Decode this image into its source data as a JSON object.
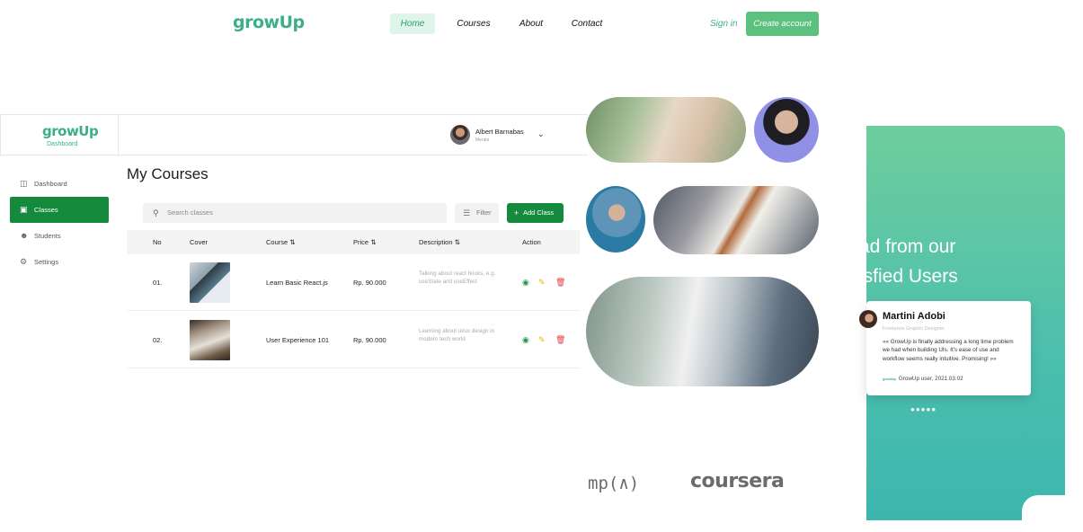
{
  "topnav": {
    "logo": "growUp",
    "links": [
      "Home",
      "Courses",
      "About",
      "Contact"
    ],
    "signin": "Sign in",
    "create": "Create account"
  },
  "dashboard": {
    "logo": "growUp",
    "logo_sub": "Dashboard",
    "user": {
      "name": "Albert Barnabas",
      "role": "Mentor"
    },
    "sidebar": [
      "Dashboard",
      "Classes",
      "Students",
      "Settings"
    ],
    "title": "My Courses",
    "search_placeholder": "Search classes",
    "filter": "Filter",
    "add": "Add Class",
    "columns": [
      "No",
      "Cover",
      "Course",
      "Price",
      "Description",
      "Action"
    ],
    "rows": [
      {
        "no": "01.",
        "course": "Learn Basic React.js",
        "price": "Rp. 90.000",
        "desc": "Talking about react hooks, e.g. useState and useEffect"
      },
      {
        "no": "02.",
        "course": "User Experience 101",
        "price": "Rp. 90.000",
        "desc": "Learning about ui/ux design in modern tech world"
      }
    ]
  },
  "brands": {
    "mp": "mp(∧)",
    "coursera": "coursera"
  },
  "testimonial": {
    "heading_line1": "ad from our",
    "heading_line2": "isfied Users",
    "name": "Martini Adobi",
    "role": "Freelance Graphic Designer",
    "quote": "«« GrowUp is finally addressing a long time problem we had when building UIs. It's ease of use and workflow seems really intuitive. Promising! »»",
    "footer_logo": "growUp",
    "footer": "GrowUp user, 2021.03.02",
    "dots": "●●●●●"
  },
  "colors": {
    "brand": "#3dae8a",
    "primary": "#168a3c",
    "panel": "#4bbfae"
  }
}
